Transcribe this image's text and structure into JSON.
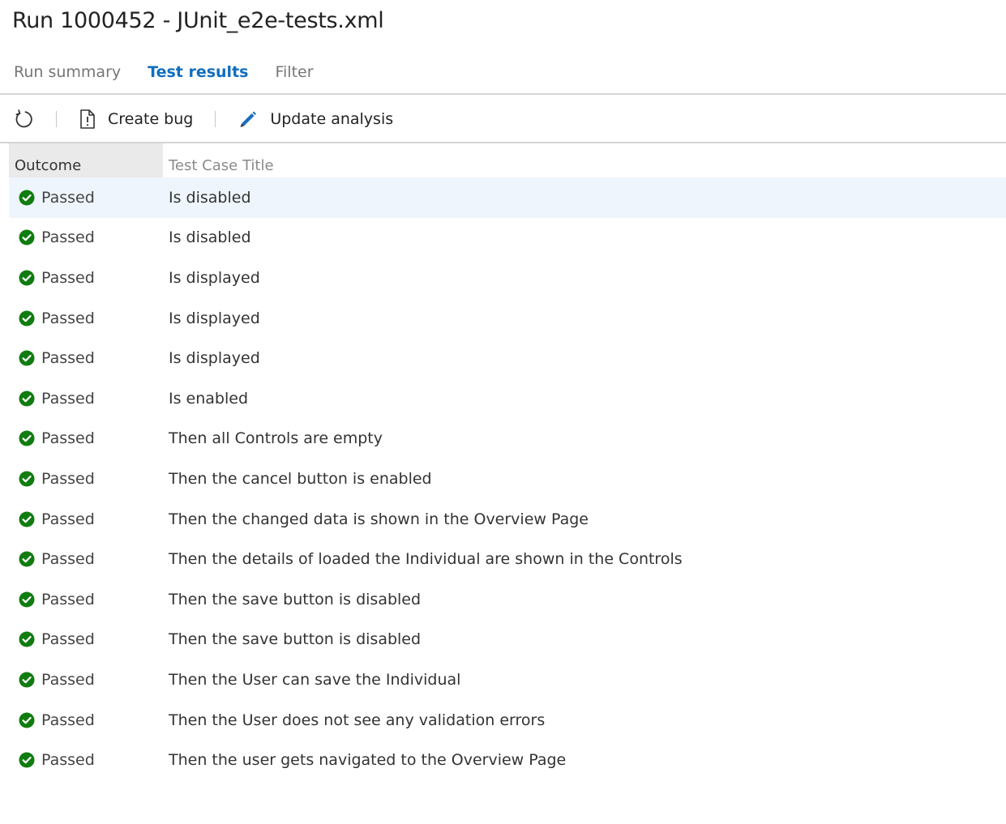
{
  "page": {
    "title": "Run 1000452 - JUnit_e2e-tests.xml"
  },
  "tabs": [
    {
      "label": "Run summary",
      "active": false
    },
    {
      "label": "Test results",
      "active": true
    },
    {
      "label": "Filter",
      "active": false
    }
  ],
  "toolbar": {
    "refresh_icon": "refresh-icon",
    "create_bug_label": "Create bug",
    "create_bug_icon": "bug-document-icon",
    "update_analysis_label": "Update analysis",
    "update_analysis_icon": "pencil-icon"
  },
  "grid": {
    "columns": [
      "Outcome",
      "Test Case Title"
    ],
    "rows": [
      {
        "outcome": "Passed",
        "title": "Is disabled"
      },
      {
        "outcome": "Passed",
        "title": "Is disabled"
      },
      {
        "outcome": "Passed",
        "title": "Is displayed"
      },
      {
        "outcome": "Passed",
        "title": "Is displayed"
      },
      {
        "outcome": "Passed",
        "title": "Is displayed"
      },
      {
        "outcome": "Passed",
        "title": "Is enabled"
      },
      {
        "outcome": "Passed",
        "title": "Then all Controls are empty"
      },
      {
        "outcome": "Passed",
        "title": "Then the cancel button is enabled"
      },
      {
        "outcome": "Passed",
        "title": "Then the changed data is shown in the Overview Page"
      },
      {
        "outcome": "Passed",
        "title": "Then the details of loaded the Individual are shown in the Controls"
      },
      {
        "outcome": "Passed",
        "title": "Then the save button is disabled"
      },
      {
        "outcome": "Passed",
        "title": "Then the save button is disabled"
      },
      {
        "outcome": "Passed",
        "title": "Then the User can save the Individual"
      },
      {
        "outcome": "Passed",
        "title": "Then the User does not see any validation errors"
      },
      {
        "outcome": "Passed",
        "title": "Then the user gets navigated to the Overview Page"
      }
    ]
  },
  "colors": {
    "accent": "#106ebe",
    "passed": "#107c10",
    "selected_row": "#eef5fc",
    "header_bg": "#eaeaea"
  }
}
